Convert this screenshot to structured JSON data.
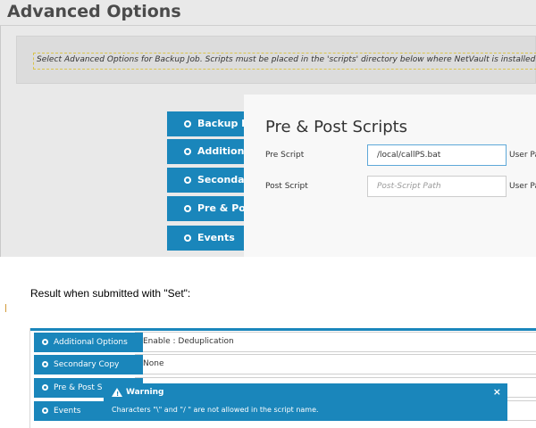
{
  "page": {
    "title": "Advanced Options",
    "info_message": "Select Advanced Options for Backup Job. Scripts must be placed in the 'scripts' directory below where NetVault is installed."
  },
  "nav": {
    "items": [
      {
        "label": "Backup Life",
        "icon": "gear-icon"
      },
      {
        "label": "Additional Options",
        "icon": "gear-icon"
      },
      {
        "label": "Secondary Copy",
        "icon": "gear-icon"
      },
      {
        "label": "Pre & Post Scripts",
        "icon": "gear-icon"
      },
      {
        "label": "Events",
        "icon": "gear-icon"
      }
    ]
  },
  "dialog": {
    "title": "Pre & Post Scripts",
    "pre_label": "Pre Script",
    "pre_value": "/local/callPS.bat",
    "pre_suffix": "User Pa",
    "post_label": "Post Script",
    "post_placeholder": "Post-Script Path",
    "post_suffix": "User Pa"
  },
  "caption": "Result when submitted with \"Set\":",
  "result": {
    "rows": [
      {
        "label": "Additional Options",
        "value": "Enable : Deduplication"
      },
      {
        "label": "Secondary Copy",
        "value": "None"
      },
      {
        "label": "Pre & Post S",
        "value": ""
      },
      {
        "label": "Events",
        "value": ""
      }
    ],
    "warning": {
      "title": "Warning",
      "message": "Characters \"\\\" and \"/ \" are not allowed in the script name.",
      "close": "×"
    }
  },
  "colors": {
    "accent": "#1a86bb",
    "panel_bg": "#e9e9e9",
    "info_border": "#d9c34a"
  }
}
